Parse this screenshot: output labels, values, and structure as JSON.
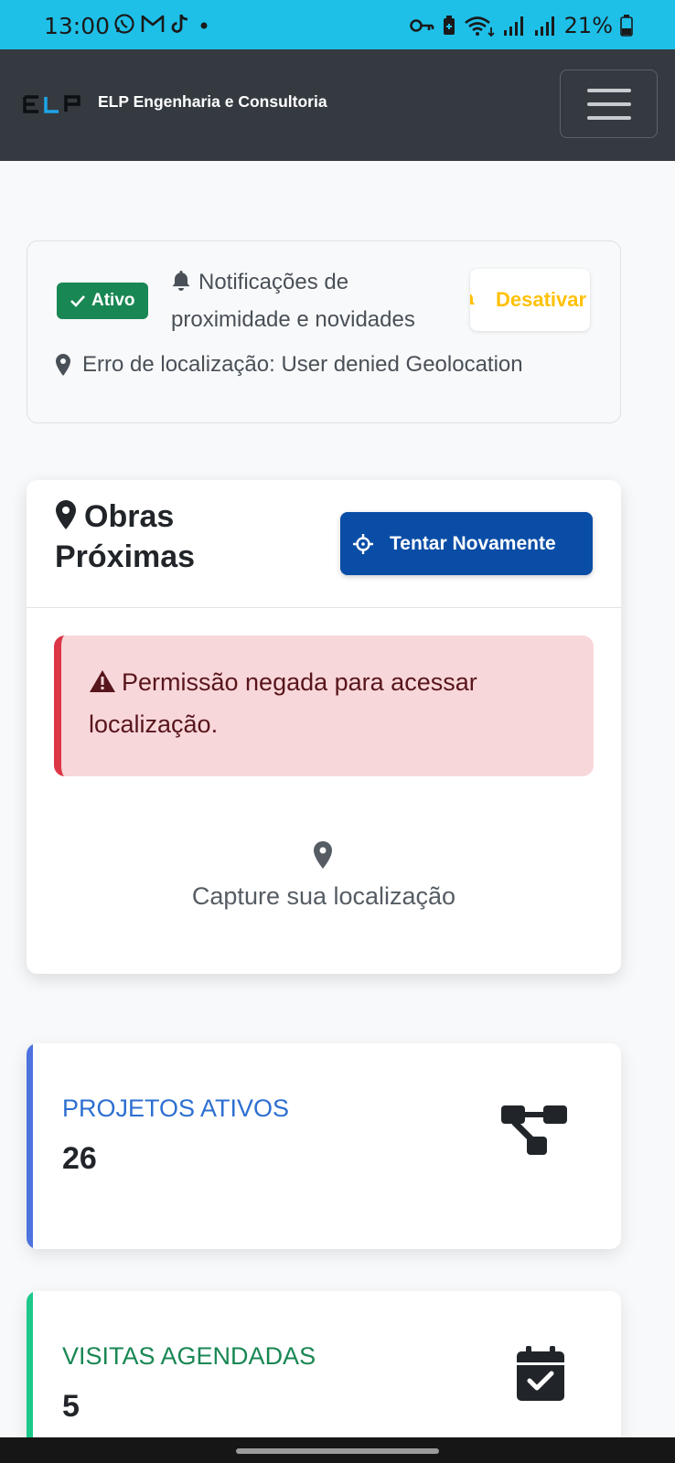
{
  "status_bar": {
    "time": "13:00",
    "battery": "21%",
    "left_icons": [
      "whatsapp-icon",
      "gmail-icon",
      "tiktok-icon",
      "dot-icon"
    ],
    "right_icons": [
      "key-icon",
      "battery-saver-icon",
      "wifi-icon",
      "signal-icon",
      "signal-icon",
      "battery-icon"
    ]
  },
  "navbar": {
    "logo_text": "ELP",
    "brand_name": "ELP Engenharia e Consultoria",
    "menu_icon": "hamburger-icon"
  },
  "notifications": {
    "status_badge": "Ativo",
    "description": "Notificações de proximidade e novidades",
    "deactivate_button": "Desativar",
    "location_error": "Erro de localização: User denied Geolocation"
  },
  "obras": {
    "title_line1": "Obras",
    "title_line2": "Próximas",
    "retry_button": "Tentar Novamente",
    "alert_message": "Permissão negada para acessar localização.",
    "capture_text": "Capture sua localização"
  },
  "stats": [
    {
      "label": "PROJETOS ATIVOS",
      "value": "26",
      "accent": "#4e73df",
      "label_color": "#2d6fd1",
      "icon": "project-diagram-icon"
    },
    {
      "label": "VISITAS AGENDADAS",
      "value": "5",
      "accent": "#1cc88a",
      "label_color": "#198754",
      "icon": "calendar-check-icon"
    }
  ],
  "colors": {
    "status_bar": "#1ec0e8",
    "navbar": "#343a40",
    "success": "#198754",
    "warning": "#ffc107",
    "primary": "#0a4da6",
    "danger": "#dc3545"
  }
}
